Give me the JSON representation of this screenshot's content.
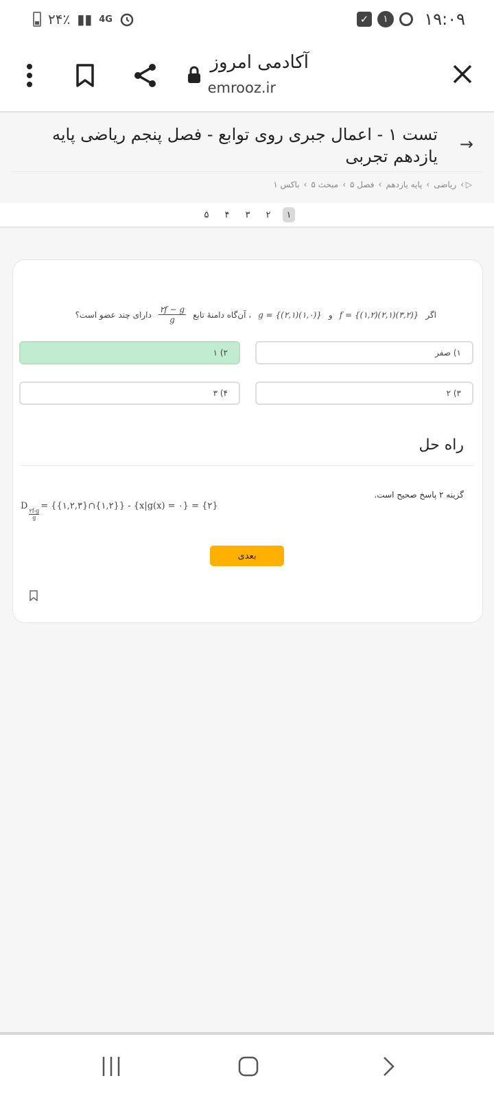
{
  "status_bar": {
    "time": "۱۹:۰۹",
    "notification_count": "۱",
    "battery": "۲۴٪",
    "network": "4G"
  },
  "browser": {
    "site_name": "آکادمی امروز",
    "site_url": "emrooz.ir"
  },
  "page": {
    "title": "تست ۱ - اعمال جبری روی توابع - فصل پنجم ریاضی پایه یازدهم تجربی",
    "breadcrumb": [
      "ریاضی",
      "پایه یازدهم",
      "فصل ۵",
      "مبحث ۵",
      "باکس ۱"
    ],
    "pages": [
      "۱",
      "۲",
      "۳",
      "۴",
      "۵"
    ],
    "active_page": "۱"
  },
  "question": {
    "if_word": "اگر",
    "f_def": "f = {(۱,۲)(۲,۱)(۳,۲)}",
    "and_word": "و",
    "g_def": "g = {(۲,۱)(۱,۰)}",
    "then_text": "، آن‌گاه دامنهٔ تابع",
    "frac_num": "۲f − g",
    "frac_den": "g",
    "end_text": "دارای چند عضو است؟"
  },
  "options": {
    "opt1": "۱) صفر",
    "opt2": "۲) ۱",
    "opt3": "۳) ۲",
    "opt4": "۴) ۳"
  },
  "solution": {
    "title": "راه حل",
    "answer_text": "گزینه ۲ پاسخ صحیح است.",
    "formula_d": "D",
    "formula_sub_num": "۲f-g",
    "formula_sub_den": "g",
    "formula_body": "= {{۱,۲,۳}∩{۱,۲}} - {x|g(x) = ۰} = {۲}"
  },
  "buttons": {
    "next": "بعدی"
  },
  "colors": {
    "correct_option": "#c1ecd0",
    "next_button": "#ffb000"
  }
}
